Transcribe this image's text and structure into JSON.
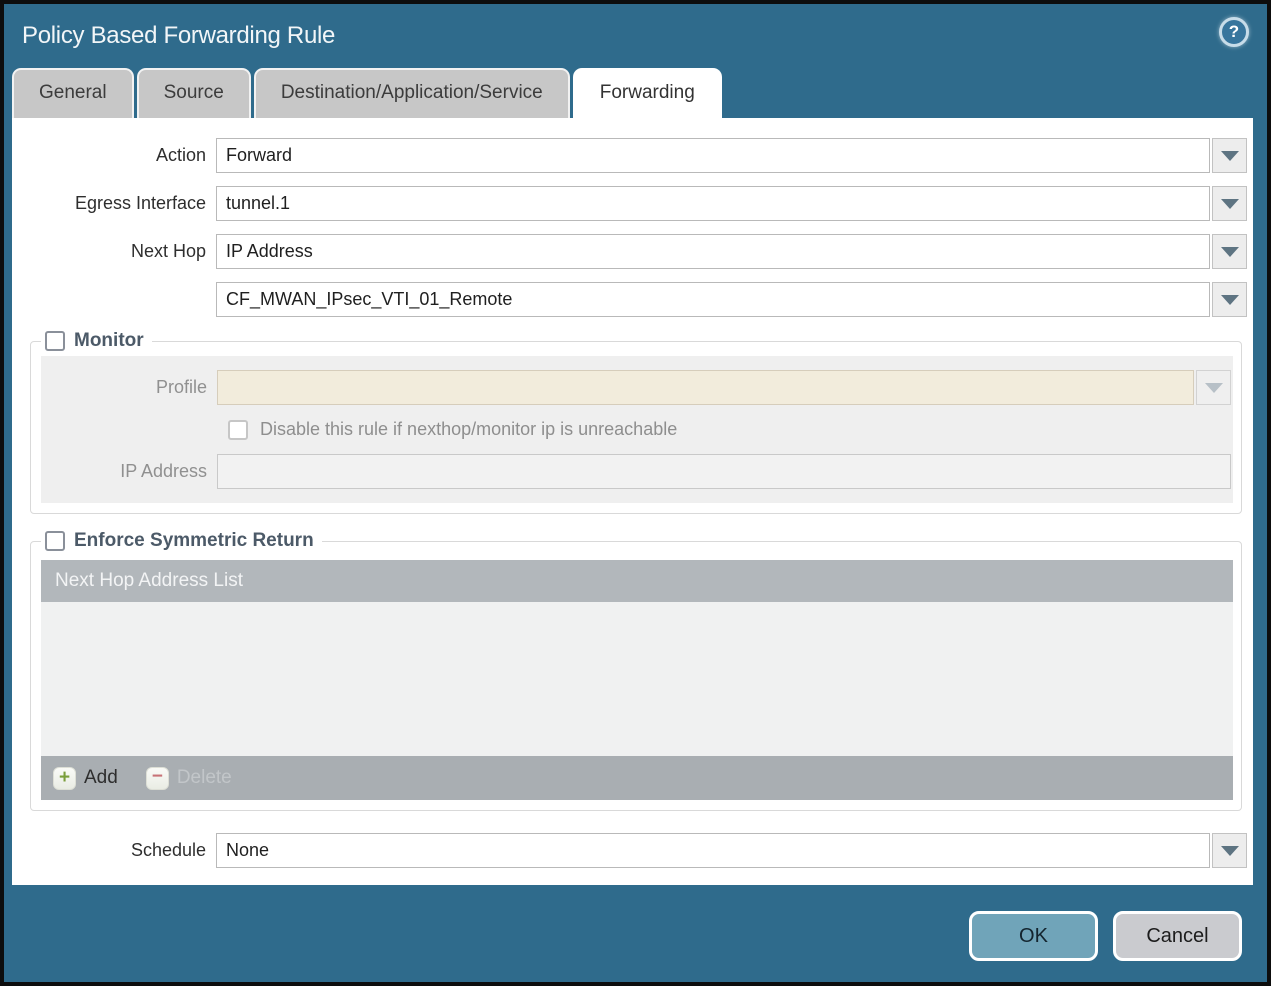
{
  "dialog": {
    "title": "Policy Based Forwarding Rule",
    "help_glyph": "?"
  },
  "tabs": [
    {
      "label": "General",
      "active": false
    },
    {
      "label": "Source",
      "active": false
    },
    {
      "label": "Destination/Application/Service",
      "active": false
    },
    {
      "label": "Forwarding",
      "active": true
    }
  ],
  "form": {
    "action": {
      "label": "Action",
      "value": "Forward"
    },
    "egress_interface": {
      "label": "Egress Interface",
      "value": "tunnel.1"
    },
    "next_hop": {
      "label": "Next Hop",
      "value": "IP Address"
    },
    "next_hop_address": {
      "value": "CF_MWAN_IPsec_VTI_01_Remote"
    },
    "schedule": {
      "label": "Schedule",
      "value": "None"
    }
  },
  "monitor": {
    "legend": "Monitor",
    "checked": false,
    "profile": {
      "label": "Profile",
      "value": ""
    },
    "disable_rule": {
      "label": "Disable this rule if nexthop/monitor ip is unreachable",
      "checked": false
    },
    "ip_address": {
      "label": "IP Address",
      "value": ""
    }
  },
  "symmetric_return": {
    "legend": "Enforce Symmetric Return",
    "checked": false,
    "table": {
      "header": "Next Hop Address List",
      "rows": []
    },
    "add_label": "Add",
    "add_glyph": "+",
    "delete_label": "Delete",
    "delete_glyph": "−",
    "delete_enabled": false
  },
  "footer": {
    "ok_label": "OK",
    "cancel_label": "Cancel"
  },
  "colors": {
    "titlebar_teal": "#2F6B8C",
    "ok_button": "#70A4B9",
    "cancel_button": "#CACBCF",
    "section_label": "#4C5A68",
    "profile_disabled_bg": "#F2ECDC",
    "table_header_bg": "#B2B7BB",
    "table_footer_bg": "#A9AEB2",
    "add_icon_green": "#7A9E3B",
    "delete_icon_red": "#C77276"
  }
}
